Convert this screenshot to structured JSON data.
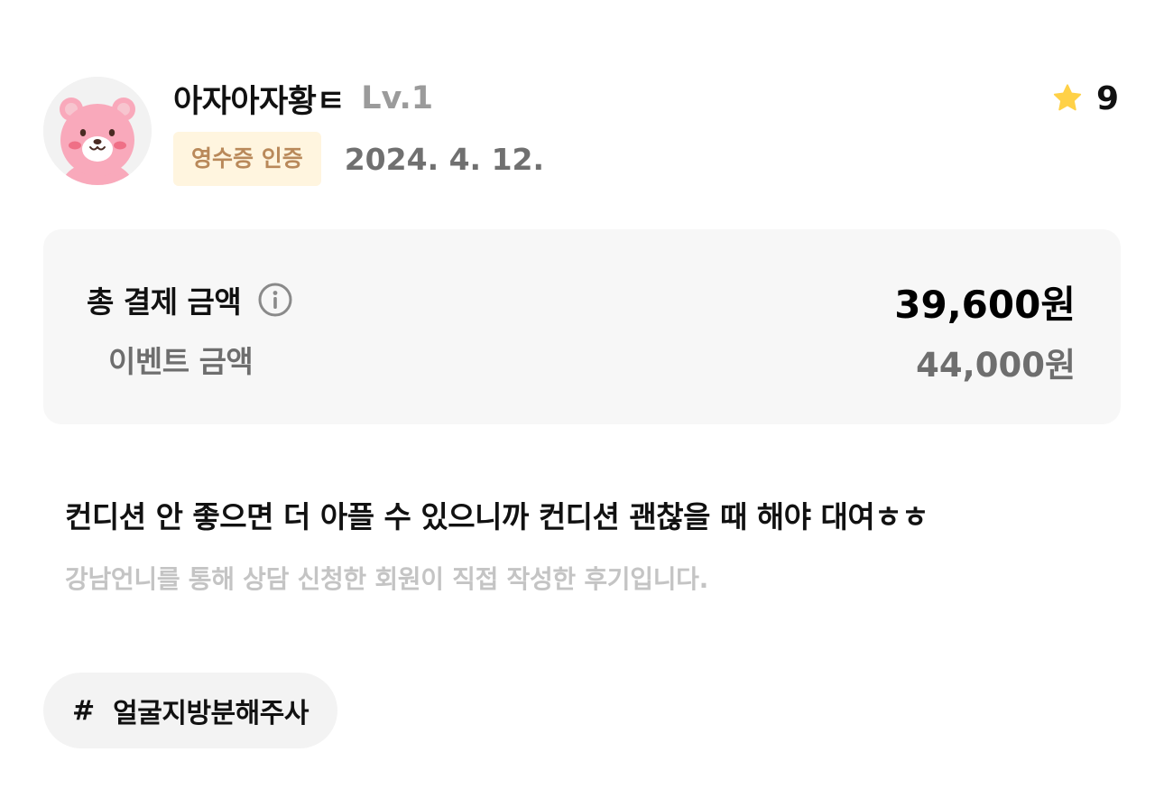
{
  "reviewer": {
    "avatar_icon": "bear-avatar-icon",
    "name": "아자아자황ㅌ",
    "level": "Lv.1",
    "verification_badge": "영수증 인증",
    "date": "2024. 4. 12.",
    "rating_icon": "star-icon",
    "rating": "9"
  },
  "price": {
    "total_label": "총 결제 금액",
    "info_icon": "info-icon",
    "total_amount": "39,600원",
    "event_label": "이벤트 금액",
    "event_amount": "44,000원"
  },
  "review": {
    "body": "컨디션 안 좋으면 더 아플 수 있으니까 컨디션 괜찮을 때 해야 대여ㅎㅎ",
    "disclaimer": "강남언니를 통해 상담 신청한 회원이 직접 작성한 후기입니다."
  },
  "tags": [
    {
      "hash": "#",
      "label": "얼굴지방분해주사"
    }
  ],
  "colors": {
    "badge_bg": "#fff5df",
    "badge_text": "#b9895a",
    "star": "#ffd147",
    "price_box_bg": "#f7f7f7",
    "chip_bg": "#f3f3f3",
    "avatar_pink": "#f9a9bb"
  }
}
